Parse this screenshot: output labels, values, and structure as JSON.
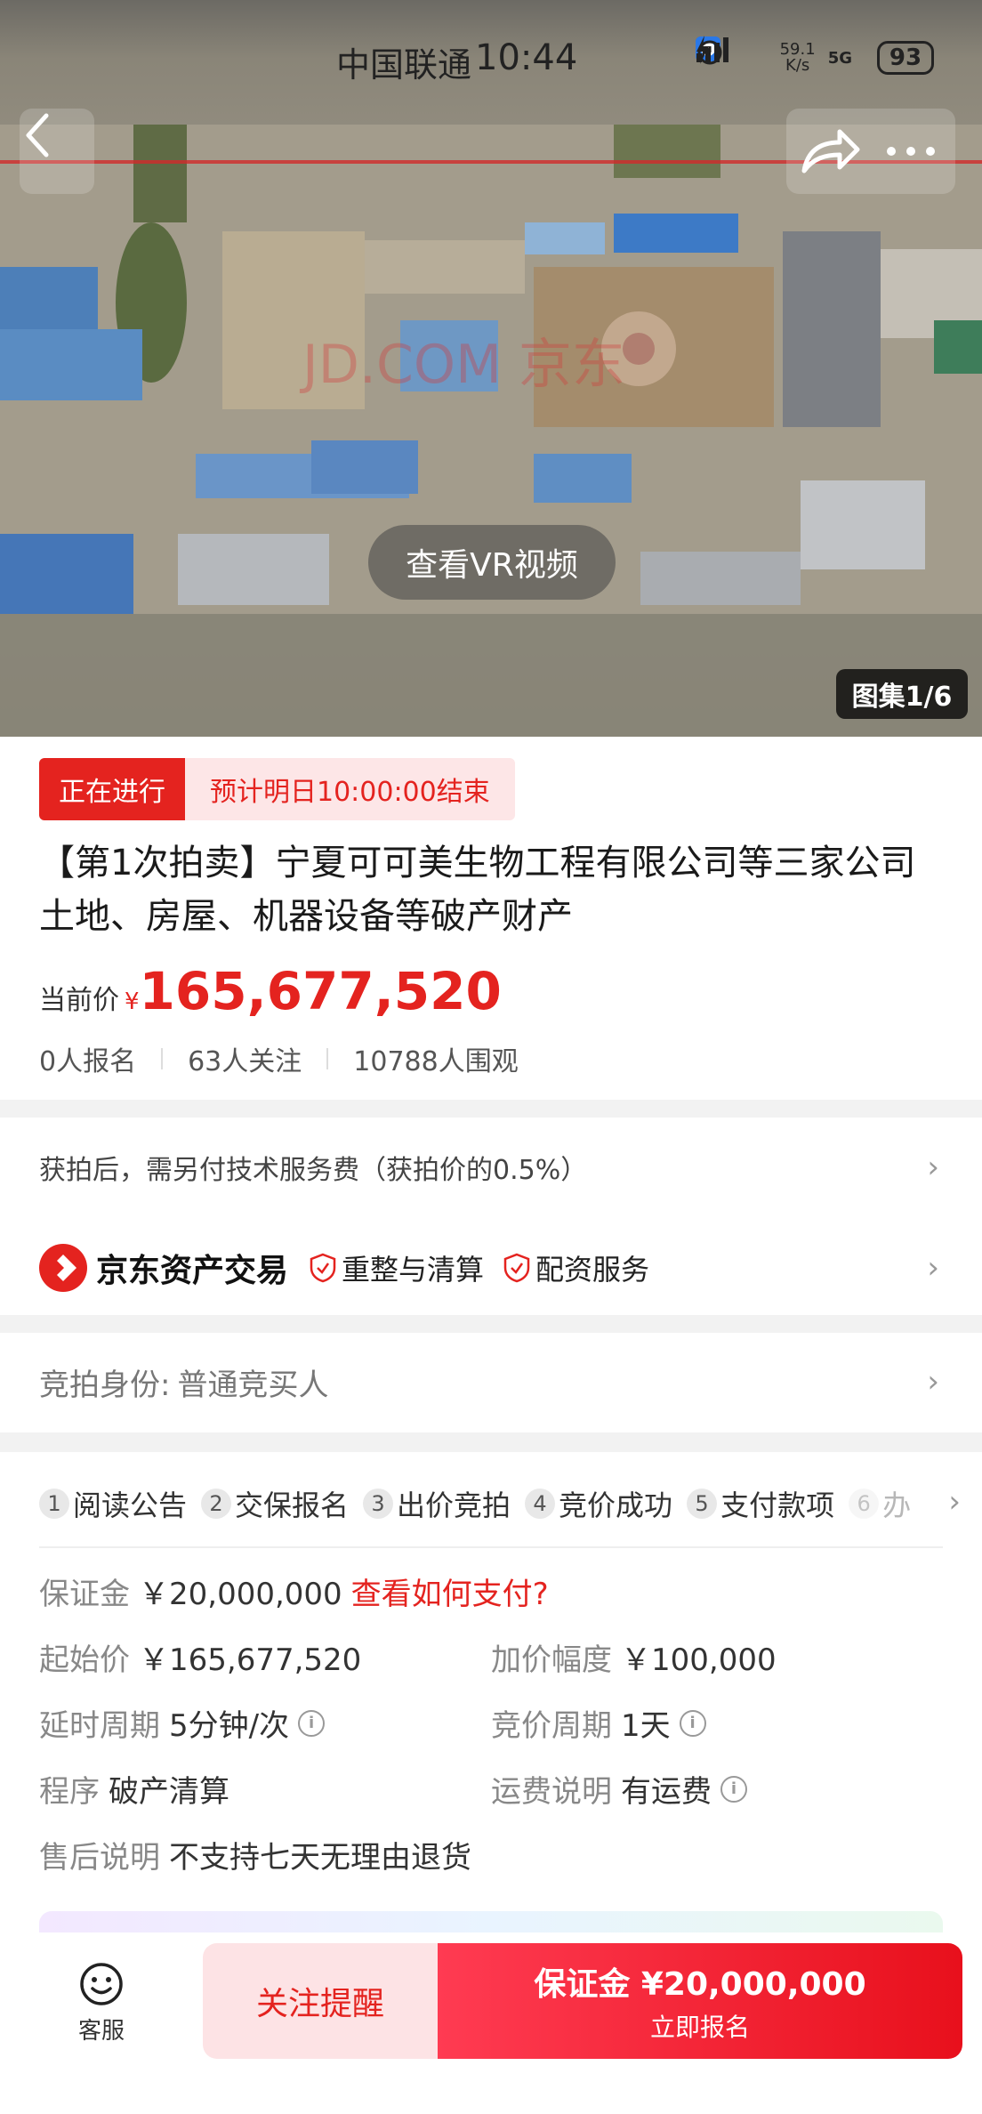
{
  "status_bar": {
    "carrier": "中国联通",
    "time": "10:44",
    "net_speed_value": "59.1",
    "net_speed_unit": "K/s",
    "network": "5G",
    "battery": "93"
  },
  "hero": {
    "watermark": "JD.COM 京东",
    "vr_button": "查看VR视频",
    "gallery_counter": "图集1/6"
  },
  "auction": {
    "status": "正在进行",
    "end_time": "预计明日10:00:00结束",
    "title": "【第1次拍卖】宁夏可可美生物工程有限公司等三家公司土地、房屋、机器设备等破产财产",
    "price_label": "当前价",
    "currency": "¥",
    "current_price": "165,677,520",
    "registrations": "0人报名",
    "followers": "63人关注",
    "viewers": "10788人围观"
  },
  "services": {
    "fee_notice": "获拍后，需另付技术服务费（获拍价的0.5%）",
    "platform_name": "京东资产交易",
    "service_1": "重整与清算",
    "service_2": "配资服务"
  },
  "bidder": {
    "label": "竞拍身份:",
    "value": "普通竞买人"
  },
  "steps": [
    {
      "num": "1",
      "label": "阅读公告"
    },
    {
      "num": "2",
      "label": "交保报名"
    },
    {
      "num": "3",
      "label": "出价竞拍"
    },
    {
      "num": "4",
      "label": "竞价成功"
    },
    {
      "num": "5",
      "label": "支付款项"
    },
    {
      "num": "6",
      "label": "办"
    }
  ],
  "details": {
    "deposit_label": "保证金",
    "deposit_value": "￥20,000,000",
    "deposit_link": "查看如何支付?",
    "start_price_label": "起始价",
    "start_price_value": "￥165,677,520",
    "increment_label": "加价幅度",
    "increment_value": "￥100,000",
    "extension_label": "延时周期",
    "extension_value": "5分钟/次",
    "bid_cycle_label": "竞价周期",
    "bid_cycle_value": "1天",
    "procedure_label": "程序",
    "procedure_value": "破产清算",
    "shipping_label": "运费说明",
    "shipping_value": "有运费",
    "after_sale_label": "售后说明",
    "after_sale_value": "不支持七天无理由退货"
  },
  "bottom_bar": {
    "customer_service": "客服",
    "follow_button": "关注提醒",
    "signup_main": "保证金 ¥20,000,000",
    "signup_sub": "立即报名"
  },
  "colors": {
    "accent": "#e4231f",
    "accent_light": "#fde6e7",
    "muted_text": "#888888"
  }
}
